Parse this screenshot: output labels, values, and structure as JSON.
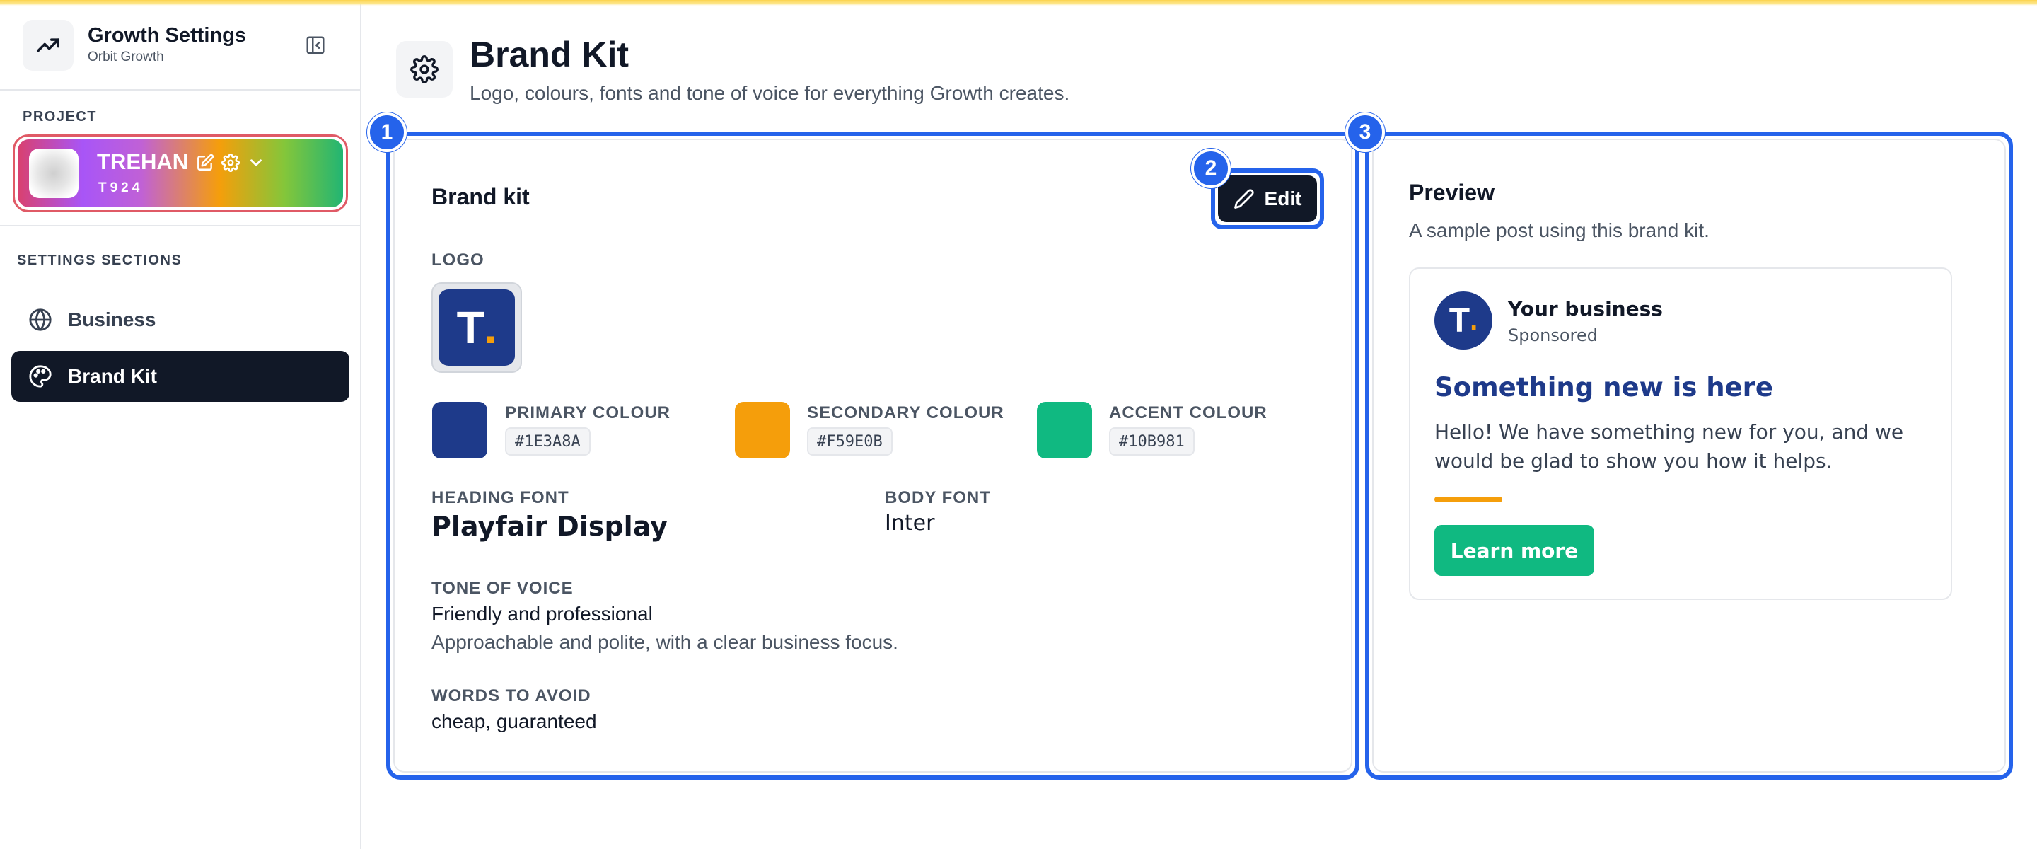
{
  "app": {
    "title": "Growth Settings",
    "subtitle": "Orbit Growth"
  },
  "sidebar": {
    "project_label": "PROJECT",
    "project": {
      "name": "TREHAN",
      "code": "T924"
    },
    "sections_label": "SETTINGS SECTIONS",
    "items": [
      {
        "label": "Business",
        "icon": "globe-icon",
        "active": false
      },
      {
        "label": "Brand Kit",
        "icon": "palette-icon",
        "active": true
      }
    ]
  },
  "page": {
    "title": "Brand Kit",
    "subtitle": "Logo, colours, fonts and tone of voice for everything Growth creates."
  },
  "badges": [
    "1",
    "2",
    "3"
  ],
  "brand_kit": {
    "title": "Brand kit",
    "edit_label": "Edit",
    "logo_label": "LOGO",
    "logo_letter": "T",
    "logo_dot": ".",
    "colours": [
      {
        "label": "PRIMARY COLOUR",
        "hex": "#1E3A8A"
      },
      {
        "label": "SECONDARY COLOUR",
        "hex": "#F59E0B"
      },
      {
        "label": "ACCENT COLOUR",
        "hex": "#10B981"
      }
    ],
    "heading_font_label": "HEADING FONT",
    "heading_font": "Playfair Display",
    "body_font_label": "BODY FONT",
    "body_font": "Inter",
    "tone_label": "TONE OF VOICE",
    "tone": "Friendly and professional",
    "tone_desc": "Approachable and polite, with a clear business focus.",
    "avoid_label": "WORDS TO AVOID",
    "avoid": "cheap, guaranteed"
  },
  "preview": {
    "title": "Preview",
    "subtitle": "A sample post using this brand kit.",
    "post": {
      "avatar_letter": "T",
      "avatar_dot": ".",
      "name": "Your business",
      "sponsored": "Sponsored",
      "headline": "Something new is here",
      "body": "Hello! We have something new for you, and we would be glad to show you how it helps.",
      "cta": "Learn more"
    }
  },
  "colors": {
    "primary": "#1E3A8A",
    "secondary": "#F59E0B",
    "accent": "#10B981",
    "highlight": "#2563EB",
    "dark": "#111827"
  }
}
